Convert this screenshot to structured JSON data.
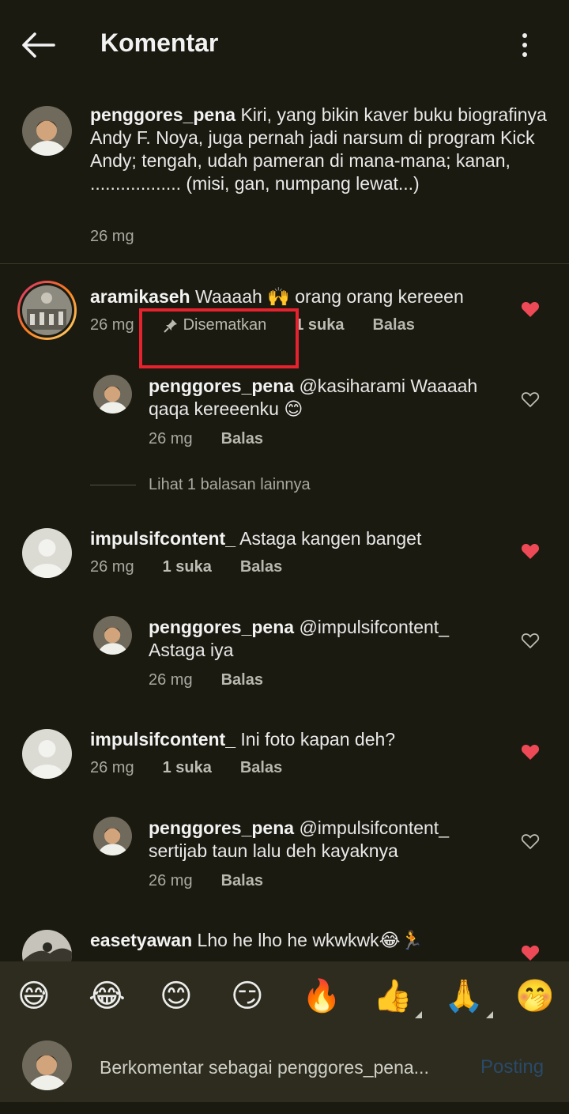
{
  "header": {
    "title": "Komentar"
  },
  "caption": {
    "username": "penggores_pena",
    "text": "Kiri, yang bikin kaver buku biografinya Andy F. Noya, juga pernah jadi narsum di program Kick Andy; tengah, udah pameran di mana-mana; kanan, .................. (misi, gan, numpang lewat...)",
    "time": "26 mg"
  },
  "comments": [
    {
      "username": "aramikaseh",
      "text": "Waaaah 🙌 orang orang kereeen",
      "time": "26 mg",
      "pinned_label": "Disematkan",
      "likes": "1 suka",
      "reply": "Balas",
      "replies": [
        {
          "username": "penggores_pena",
          "text": "@kasiharami Waaaah qaqa kereeenku 😊",
          "time": "26 mg",
          "reply": "Balas"
        }
      ],
      "more_replies": "Lihat 1 balasan lainnya"
    },
    {
      "username": "impulsifcontent_",
      "text": "Astaga kangen banget",
      "time": "26 mg",
      "likes": "1 suka",
      "reply": "Balas",
      "replies": [
        {
          "username": "penggores_pena",
          "text": "@impulsifcontent_ Astaga iya",
          "time": "26 mg",
          "reply": "Balas"
        }
      ]
    },
    {
      "username": "impulsifcontent_",
      "text": "Ini foto kapan deh?",
      "time": "26 mg",
      "likes": "1 suka",
      "reply": "Balas",
      "replies": [
        {
          "username": "penggores_pena",
          "text": "@impulsifcontent_ sertijab taun lalu deh kayaknya",
          "time": "26 mg",
          "reply": "Balas"
        }
      ]
    },
    {
      "username": "easetyawan",
      "text": "Lho he lho he wkwkwk😂🏃"
    }
  ],
  "emojis": [
    "😅",
    "😂",
    "😊",
    "😏",
    "🔥",
    "👍",
    "🙏",
    "🤭"
  ],
  "composer": {
    "placeholder": "Berkomentar sebagai penggores_pena...",
    "post_label": "Posting"
  },
  "colors": {
    "background": "#1b1a10",
    "heart_liked": "#ed4956",
    "highlight_box": "#e5222d",
    "post_button_disabled": "#2a4a6a"
  }
}
